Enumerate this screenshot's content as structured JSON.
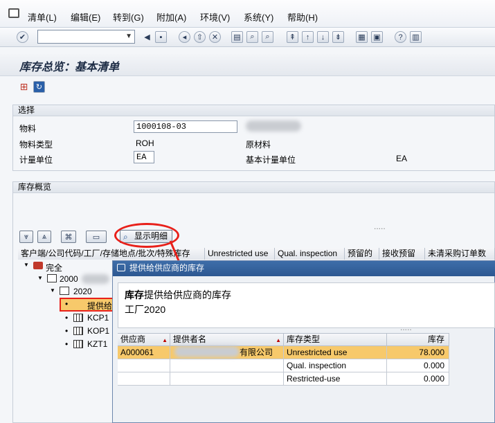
{
  "menu": {
    "items": [
      "清单(L)",
      "编辑(E)",
      "转到(G)",
      "附加(A)",
      "环境(V)",
      "系统(Y)",
      "帮助(H)"
    ]
  },
  "toolbar": {
    "command_value": ""
  },
  "page": {
    "title": "库存总览：基本清单"
  },
  "selection": {
    "group_title": "选择",
    "material_label": "物料",
    "material_value": "1000108-03",
    "material_type_label": "物料类型",
    "material_type_value": "ROH",
    "material_type_desc": "原材料",
    "uom_label": "计量单位",
    "uom_value": "EA",
    "base_uom_label": "基本计量单位",
    "base_uom_value": "EA"
  },
  "overview": {
    "group_title": "库存概览",
    "detail_button": "显示明细",
    "columns": [
      "客户端/公司代码/工厂/存储地点/批次/特殊库存",
      "Unrestricted use",
      "Qual. inspection",
      "预留的",
      "接收预留",
      "未清采购订单数"
    ],
    "tree": {
      "complete": "完全",
      "company": "2000",
      "plant": "2020",
      "supplier_node": "提供给",
      "locations": [
        "KCP1",
        "KOP1",
        "KZT1"
      ]
    }
  },
  "popup": {
    "title": "提供给供应商的库存",
    "heading_bold": "库存",
    "heading_rest": "提供给供应商的库存",
    "plant_line": "工厂2020",
    "columns": {
      "vendor": "供应商",
      "vendor_name": "提供者名",
      "stock_type": "库存类型",
      "stock": "库存"
    },
    "rows": [
      {
        "vendor": "A000061",
        "vendor_name": "有限公司",
        "stock_type": "Unrestricted use",
        "stock": "78.000"
      },
      {
        "vendor": "",
        "vendor_name": "",
        "stock_type": "Qual. inspection",
        "stock": "0.000"
      },
      {
        "vendor": "",
        "vendor_name": "",
        "stock_type": "Restricted-use",
        "stock": "0.000"
      }
    ]
  },
  "colors": {
    "highlight_row": "#f7c96b",
    "annotation_red": "#e8201a",
    "popup_title": "#2d5891"
  }
}
